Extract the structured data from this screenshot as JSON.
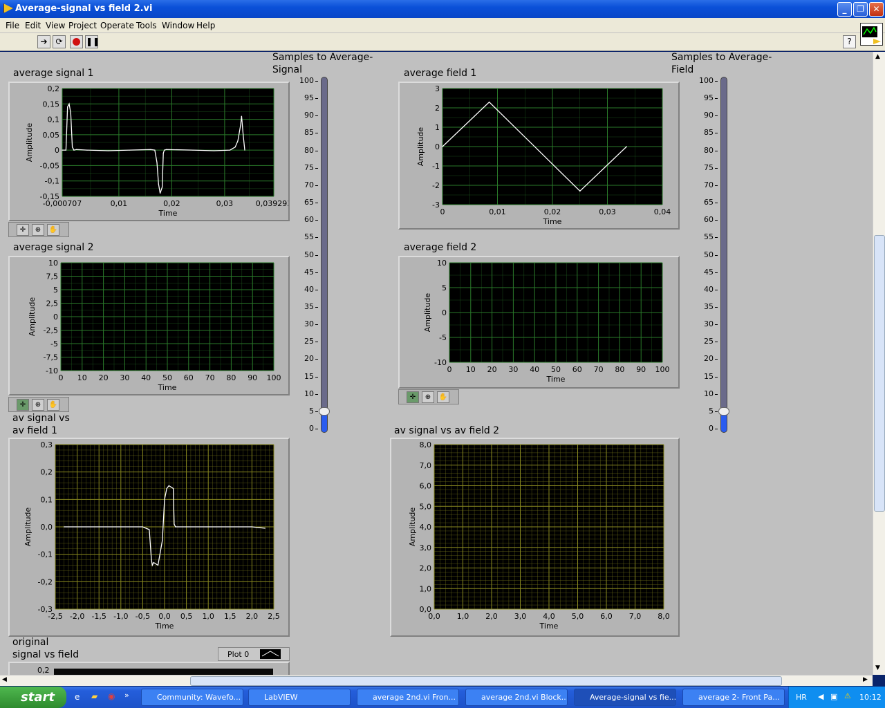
{
  "window": {
    "title": "Average-signal vs field 2.vi"
  },
  "menu": [
    "File",
    "Edit",
    "View",
    "Project",
    "Operate",
    "Tools",
    "Window",
    "Help"
  ],
  "sliders": [
    {
      "label": "Samples to Average-\nSignal",
      "value": 5,
      "max": 100,
      "ticks": [
        "100",
        "95",
        "90",
        "85",
        "80",
        "75",
        "70",
        "65",
        "60",
        "55",
        "50",
        "45",
        "40",
        "35",
        "30",
        "25",
        "20",
        "15",
        "10",
        "5",
        "0"
      ]
    },
    {
      "label": "Samples to Average-\nField",
      "value": 5,
      "max": 100,
      "ticks": [
        "100",
        "95",
        "90",
        "85",
        "80",
        "75",
        "70",
        "65",
        "60",
        "55",
        "50",
        "45",
        "40",
        "35",
        "30",
        "25",
        "20",
        "15",
        "10",
        "5",
        "0"
      ]
    }
  ],
  "graphs": {
    "g1": {
      "label": "average signal 1",
      "xlabel": "Time",
      "ylabel": "Amplitude"
    },
    "g2": {
      "label": "average signal 2",
      "xlabel": "Time",
      "ylabel": "Amplitude"
    },
    "g3": {
      "label": "av signal vs\nav field 1",
      "xlabel": "Time",
      "ylabel": "Amplitude"
    },
    "g4": {
      "label": "average field 1",
      "xlabel": "Time",
      "ylabel": "Amplitude"
    },
    "g5": {
      "label": "average field 2",
      "xlabel": "Time",
      "ylabel": "Amplitude"
    },
    "g6": {
      "label": "av signal vs av field 2",
      "xlabel": "Time",
      "ylabel": "Amplitude"
    },
    "g7": {
      "label": "original\nsignal vs field",
      "legend": "Plot 0",
      "ytop": "0,2"
    }
  },
  "chart_data": [
    {
      "id": "g1",
      "type": "line",
      "xticks": [
        "-0,000707",
        "0,01",
        "0,02",
        "0,03",
        "0,039293"
      ],
      "xtickvals": [
        -0.000707,
        0.01,
        0.02,
        0.03,
        0.039293
      ],
      "xlim": [
        -0.000707,
        0.039293
      ],
      "yticks": [
        "0,2",
        "0,15",
        "0,1",
        "0,05",
        "0",
        "-0,05",
        "-0,1",
        "-0,15"
      ],
      "ytickvals": [
        0.2,
        0.15,
        0.1,
        0.05,
        0,
        -0.05,
        -0.1,
        -0.15
      ],
      "ylim": [
        -0.15,
        0.2
      ],
      "grid": true,
      "gridcolor": "#2a7a2a",
      "linecolor": "#ffffff",
      "x": [
        -0.0007,
        0.0,
        0.0003,
        0.0006,
        0.0009,
        0.0012,
        0.0015,
        0.002,
        0.004,
        0.008,
        0.012,
        0.016,
        0.0168,
        0.0172,
        0.0175,
        0.0178,
        0.0182,
        0.0184,
        0.0186,
        0.019,
        0.024,
        0.028,
        0.031,
        0.032,
        0.0325,
        0.033,
        0.0332,
        0.0335,
        0.0338
      ],
      "y": [
        0.0,
        0.0,
        0.14,
        0.15,
        0.12,
        0.01,
        0.0,
        0.002,
        0.0,
        -0.002,
        0.0,
        0.002,
        0.0,
        -0.04,
        -0.11,
        -0.14,
        -0.12,
        -0.01,
        0.0,
        0.002,
        0.0,
        -0.002,
        0.0,
        0.01,
        0.03,
        0.08,
        0.11,
        0.05,
        0.0
      ]
    },
    {
      "id": "g2",
      "type": "line",
      "xticks": [
        "0",
        "10",
        "20",
        "30",
        "40",
        "50",
        "60",
        "70",
        "80",
        "90",
        "100"
      ],
      "xtickvals": [
        0,
        10,
        20,
        30,
        40,
        50,
        60,
        70,
        80,
        90,
        100
      ],
      "xlim": [
        0,
        100
      ],
      "yticks": [
        "10",
        "7,5",
        "5",
        "2,5",
        "0",
        "-2,5",
        "-5",
        "-7,5",
        "-10"
      ],
      "ytickvals": [
        10,
        7.5,
        5,
        2.5,
        0,
        -2.5,
        -5,
        -7.5,
        -10
      ],
      "ylim": [
        -10,
        10
      ],
      "grid": true,
      "gridcolor": "#2a7a2a",
      "linecolor": "#ffffff",
      "x": [],
      "y": []
    },
    {
      "id": "g3",
      "type": "line",
      "xticks": [
        "-2,5",
        "-2,0",
        "-1,5",
        "-1,0",
        "-0,5",
        "0,0",
        "0,5",
        "1,0",
        "1,5",
        "2,0",
        "2,5"
      ],
      "xtickvals": [
        -2.5,
        -2,
        -1.5,
        -1,
        -0.5,
        0,
        0.5,
        1,
        1.5,
        2,
        2.5
      ],
      "xlim": [
        -2.5,
        2.5
      ],
      "yticks": [
        "0,3",
        "0,2",
        "0,1",
        "0,0",
        "-0,1",
        "-0,2",
        "-0,3"
      ],
      "ytickvals": [
        0.3,
        0.2,
        0.1,
        0,
        -0.1,
        -0.2,
        -0.3
      ],
      "ylim": [
        -0.3,
        0.3
      ],
      "grid": true,
      "gridcolor": "#8a8a20",
      "linecolor": "#ffffff",
      "x": [
        -2.3,
        -1.5,
        -0.5,
        -0.35,
        -0.3,
        -0.28,
        -0.25,
        -0.15,
        -0.05,
        0.0,
        0.05,
        0.1,
        0.2,
        0.22,
        0.25,
        0.5,
        1.0,
        2.0,
        2.3
      ],
      "y": [
        0.0,
        0.0,
        0.0,
        -0.01,
        -0.12,
        -0.14,
        -0.13,
        -0.14,
        -0.05,
        0.1,
        0.14,
        0.15,
        0.14,
        0.01,
        0.0,
        0.0,
        0.0,
        0.0,
        -0.005
      ]
    },
    {
      "id": "g4",
      "type": "line",
      "xticks": [
        "0",
        "0,01",
        "0,02",
        "0,03",
        "0,04"
      ],
      "xtickvals": [
        0,
        0.01,
        0.02,
        0.03,
        0.04
      ],
      "xlim": [
        0,
        0.04
      ],
      "yticks": [
        "3",
        "2",
        "1",
        "0",
        "-1",
        "-2",
        "-3"
      ],
      "ytickvals": [
        3,
        2,
        1,
        0,
        -1,
        -2,
        -3
      ],
      "ylim": [
        -3,
        3
      ],
      "grid": true,
      "gridcolor": "#2a7a2a",
      "linecolor": "#ffffff",
      "x": [
        0,
        0.0085,
        0.025,
        0.0335
      ],
      "y": [
        0,
        2.3,
        -2.3,
        0
      ]
    },
    {
      "id": "g5",
      "type": "line",
      "xticks": [
        "0",
        "10",
        "20",
        "30",
        "40",
        "50",
        "60",
        "70",
        "80",
        "90",
        "100"
      ],
      "xtickvals": [
        0,
        10,
        20,
        30,
        40,
        50,
        60,
        70,
        80,
        90,
        100
      ],
      "xlim": [
        0,
        100
      ],
      "yticks": [
        "10",
        "5",
        "0",
        "-5",
        "-10"
      ],
      "ytickvals": [
        10,
        5,
        0,
        -5,
        -10
      ],
      "ylim": [
        -10,
        10
      ],
      "grid": true,
      "gridcolor": "#2a7a2a",
      "linecolor": "#ffffff",
      "x": [],
      "y": []
    },
    {
      "id": "g6",
      "type": "line",
      "xticks": [
        "0,0",
        "1,0",
        "2,0",
        "3,0",
        "4,0",
        "5,0",
        "6,0",
        "7,0",
        "8,0"
      ],
      "xtickvals": [
        0,
        1,
        2,
        3,
        4,
        5,
        6,
        7,
        8
      ],
      "xlim": [
        0,
        8
      ],
      "yticks": [
        "8,0",
        "7,0",
        "6,0",
        "5,0",
        "4,0",
        "3,0",
        "2,0",
        "1,0",
        "0,0"
      ],
      "ytickvals": [
        8,
        7,
        6,
        5,
        4,
        3,
        2,
        1,
        0
      ],
      "ylim": [
        0,
        8
      ],
      "grid": true,
      "gridcolor": "#8a8a20",
      "linecolor": "#ffffff",
      "x": [],
      "y": []
    }
  ],
  "taskbar": {
    "start": "start",
    "tasks": [
      "Community: Wavefo...",
      "LabVIEW",
      "average 2nd.vi Fron...",
      "average 2nd.vi Block...",
      "Average-signal vs fie...",
      "average 2- Front Pa..."
    ],
    "lang": "HR",
    "clock": "10:12"
  }
}
